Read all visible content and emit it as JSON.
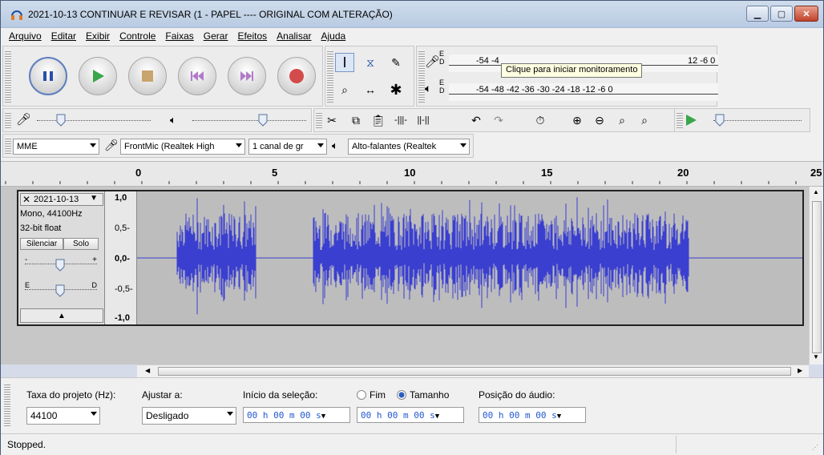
{
  "window": {
    "title": "2021-10-13 CONTINUAR E REVISAR (1 - PAPEL ---- ORIGINAL COM ALTERAÇÃO)"
  },
  "menu": [
    "Arquivo",
    "Editar",
    "Exibir",
    "Controle",
    "Faixas",
    "Gerar",
    "Efeitos",
    "Analisar",
    "Ajuda"
  ],
  "meters": {
    "record_ticks": "-54    -4",
    "record_tail": "12    -6    0",
    "playback_ticks": "-54    -48    -42    -36    -30    -24    -18    -12    -6    0",
    "record_channels": "E\nD",
    "tooltip": "Clique para iniciar monitoramento"
  },
  "device": {
    "host": "MME",
    "input": "FrontMic (Realtek High",
    "channels": "1 canal de gr",
    "output": "Alto-falantes (Realtek"
  },
  "ruler": {
    "labels": [
      "0",
      "5",
      "10",
      "15",
      "20",
      "25"
    ]
  },
  "track": {
    "name": "2021-10-13",
    "format": "Mono, 44100Hz",
    "bitdepth": "32-bit float",
    "mute": "Silenciar",
    "solo": "Solo",
    "gain_left": "-",
    "gain_right": "+",
    "pan_left": "E",
    "pan_right": "D",
    "scale": [
      "1,0",
      "0,5-",
      "0,0-",
      "-0,5-",
      "-1,0"
    ]
  },
  "selection": {
    "rate_label": "Taxa do projeto (Hz):",
    "rate_value": "44100",
    "snap_label": "Ajustar a:",
    "snap_value": "Desligado",
    "start_label": "Início da seleção:",
    "end_label": "Fim",
    "length_label": "Tamanho",
    "start_time": "00 h 00 m 00 s",
    "end_time": "00 h 00 m 00 s",
    "position_label": "Posição do áudio:",
    "position_time": "00 h 00 m 00 s"
  },
  "status": {
    "text": "Stopped."
  },
  "colors": {
    "wave": "#3a3fd0",
    "play": "#3aa64a",
    "record": "#d44b4b"
  }
}
